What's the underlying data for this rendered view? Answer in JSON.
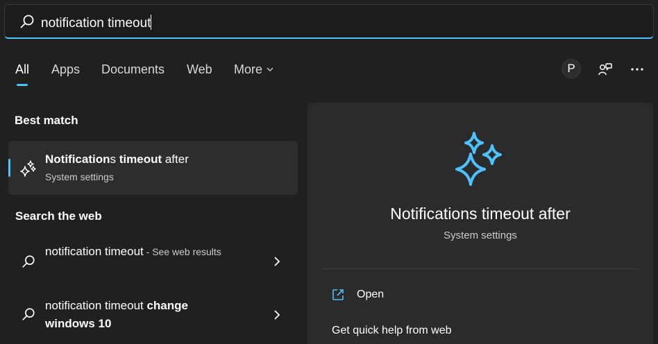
{
  "search": {
    "query": "notification timeout"
  },
  "tabs": [
    {
      "label": "All"
    },
    {
      "label": "Apps"
    },
    {
      "label": "Documents"
    },
    {
      "label": "Web"
    },
    {
      "label": "More"
    }
  ],
  "header_actions": {
    "avatar_letter": "P"
  },
  "best_match": {
    "section_title": "Best match",
    "title_bold_1": "Notification",
    "title_normal_1": "s ",
    "title_bold_2": "timeout",
    "title_normal_2": " after",
    "subtitle": "System settings"
  },
  "web": {
    "section_title": "Search the web",
    "items": [
      {
        "text": "notification timeout",
        "suffix": " - See web results"
      },
      {
        "text": "notification timeout ",
        "bold_suffix": "change windows 10"
      }
    ]
  },
  "preview": {
    "title": "Notifications timeout after",
    "subtitle": "System settings",
    "open_label": "Open",
    "quick_help": "Get quick help from web"
  },
  "colors": {
    "accent": "#4cc2ff",
    "background": "#202020",
    "panel": "#2b2b2b"
  },
  "icons": {
    "search": "search-icon",
    "settings_sparkle": "sparkle-icon",
    "open": "open-external-icon",
    "more_options": "ellipsis-icon",
    "feedback": "feedback-icon",
    "chevron": "chevron-right-icon"
  }
}
